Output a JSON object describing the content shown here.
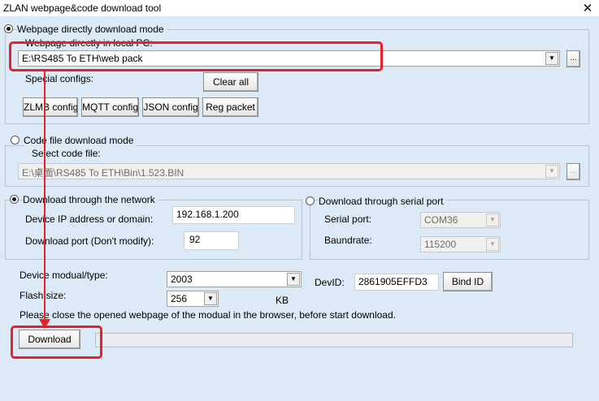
{
  "window": {
    "title": "ZLAN webpage&code download tool",
    "close": "✕"
  },
  "webpage_mode": {
    "radio_label": "Webpage directly download mode",
    "path_label": "Webpage directly in local PC:",
    "path_value": "E:\\RS485 To ETH\\web pack",
    "browse": "...",
    "special_configs_label": "Special configs:",
    "clear_all": "Clear all",
    "buttons": [
      "ZLMB config",
      "MQTT config",
      "JSON config",
      "Reg packet"
    ]
  },
  "code_mode": {
    "radio_label": "Code file download mode",
    "select_label": "Select code file:",
    "path_value": "E:\\桌面\\RS485 To ETH\\Bin\\1.523.BIN",
    "browse": "..."
  },
  "network": {
    "radio_label": "Download through the network",
    "ip_label": "Device IP address or domain:",
    "ip_value": "192.168.1.200",
    "port_label": "Download port (Don't modify):",
    "port_value": "92"
  },
  "serial": {
    "radio_label": "Download through serial port",
    "port_label": "Serial port:",
    "port_value": "COM36",
    "baud_label": "Baundrate:",
    "baud_value": "115200"
  },
  "device": {
    "type_label": "Device modual/type:",
    "type_value": "2003",
    "flash_label": "Flash size:",
    "flash_value": "256",
    "kb": "KB",
    "devid_label": "DevID:",
    "devid_value": "2861905EFFD3",
    "bind_id": "Bind ID"
  },
  "notice": "Please close the opened webpage of the modual in the browser, before start download.",
  "download": "Download",
  "progress": 0,
  "colors": {
    "background": "#dce9f7",
    "highlight": "#e8202a"
  }
}
